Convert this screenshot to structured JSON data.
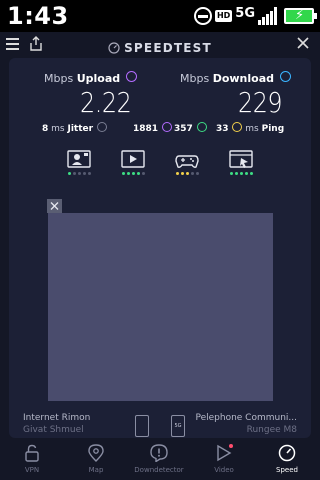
{
  "status_bar": {
    "time": "1:43",
    "hd_badge": "HD",
    "network": "5G"
  },
  "header": {
    "title": "SPEEDTEST"
  },
  "upload": {
    "unit": "Mbps",
    "label": "Upload",
    "value": "2.22"
  },
  "download": {
    "unit": "Mbps",
    "label": "Download",
    "value": "229"
  },
  "stats": {
    "jitter_value": "8",
    "jitter_unit": "ms",
    "jitter_label": "Jitter",
    "upload_count": "1881",
    "download_count": "357",
    "ping_value": "33",
    "ping_unit": "ms",
    "ping_label": "Ping"
  },
  "connection": {
    "provider": "Internet Rimon",
    "provider_location": "Givat Shmuel",
    "server": "Pelephone Communi...",
    "server_location": "Rungee M8",
    "sim_label": "5G"
  },
  "nav": {
    "vpn": "VPN",
    "map": "Map",
    "downdetector": "Downdetector",
    "video": "Video",
    "speed": "Speed"
  },
  "colors": {
    "upload_accent": "#b36bff",
    "download_accent": "#3ab4ff",
    "rating_green": "#3ddc84",
    "rating_yellow": "#f2d04b",
    "battery": "#32d74b",
    "notification_dot": "#ff4d6d"
  }
}
